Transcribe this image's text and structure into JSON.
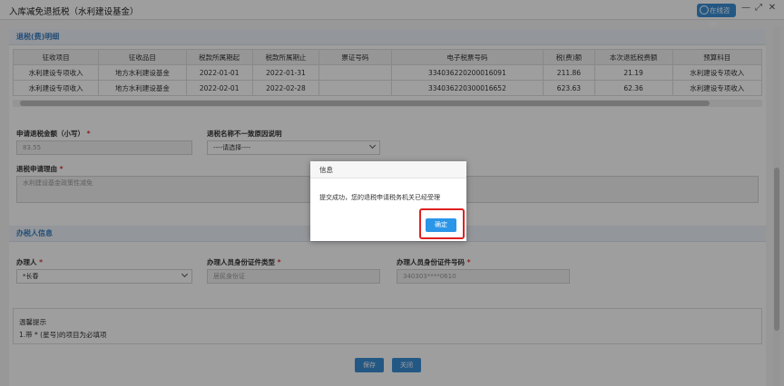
{
  "window": {
    "title": "入库减免退抵税（水利建设基金）",
    "help_label": "在线咨询",
    "minimize": "—",
    "maximize": "⤢",
    "close": "✕"
  },
  "detail": {
    "section_title": "退税(费)明细",
    "columns": [
      "征收项目",
      "征收品目",
      "税款所属期起",
      "税款所属期止",
      "票证号码",
      "电子税票号码",
      "税(费)额",
      "本次退抵税费额",
      "预算科目"
    ],
    "rows": [
      [
        "水利建设专项收入",
        "地方水利建设基金",
        "2022-01-01",
        "2022-01-31",
        "",
        "334036220200016091",
        "211.86",
        "21.19",
        "水利建设专项收入"
      ],
      [
        "水利建设专项收入",
        "地方水利建设基金",
        "2022-02-01",
        "2022-02-28",
        "",
        "334036220300016652",
        "623.63",
        "62.36",
        "水利建设专项收入"
      ]
    ]
  },
  "form": {
    "amount_label": "申请退税金额（小写）",
    "amount_value": "83.55",
    "reason_mismatch_label": "退税名称不一致原因说明",
    "reason_mismatch_value": "----请选择----",
    "reason_label": "退税申请理由",
    "reason_placeholder": "水利建设基金政策性减免"
  },
  "agent": {
    "section_title": "办税人信息",
    "person_label": "办理人",
    "person_value": "*长春",
    "id_type_label": "办理人员身份证件类型",
    "id_type_value": "居民身份证",
    "id_no_label": "办理人员身份证件号码",
    "id_no_value": "340303****0610"
  },
  "tips": {
    "title": "温馨提示",
    "line": "1.带 * (星号)的项目为必填项"
  },
  "buttons": {
    "save": "保存",
    "close": "关闭"
  },
  "dialog": {
    "title": "信息",
    "message": "提交成功，您的退税申请税务机关已经受理",
    "ok": "确定"
  },
  "colors": {
    "accent": "#3b8fd6",
    "highlight": "#e02020"
  }
}
